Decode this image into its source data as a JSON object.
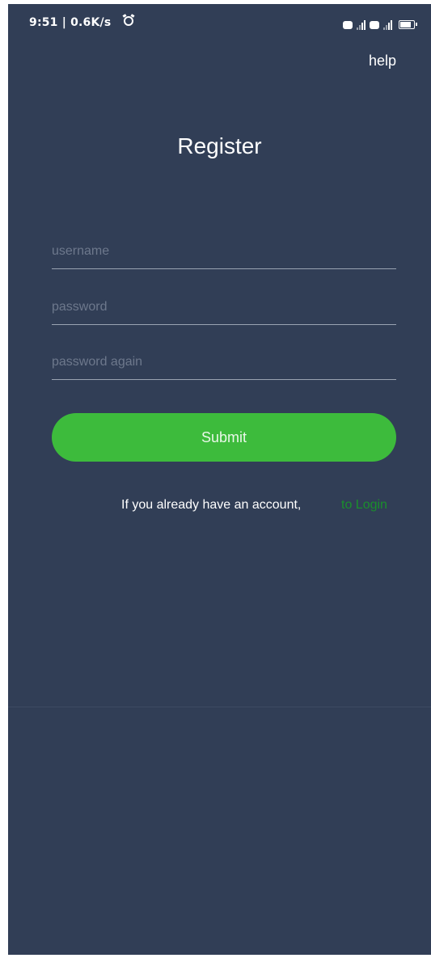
{
  "status_bar": {
    "time_and_speed": "9:51 | 0.6K/s",
    "icons": [
      "alarm-icon",
      "hd-icon",
      "signal-icon",
      "hd-icon",
      "signal-icon",
      "battery-icon"
    ]
  },
  "header": {
    "help_label": "help"
  },
  "main": {
    "title": "Register",
    "fields": {
      "username_placeholder": "username",
      "password_placeholder": "password",
      "password_again_placeholder": "password again",
      "username_value": "",
      "password_value": "",
      "password_again_value": ""
    },
    "submit_label": "Submit",
    "login_prompt": "If you already have an account,",
    "login_link": "to Login"
  },
  "colors": {
    "background": "#313e56",
    "accent_green": "#3dbb3c",
    "link_green": "#1a8f2c",
    "text": "#ffffff",
    "placeholder": "#6d788c"
  }
}
